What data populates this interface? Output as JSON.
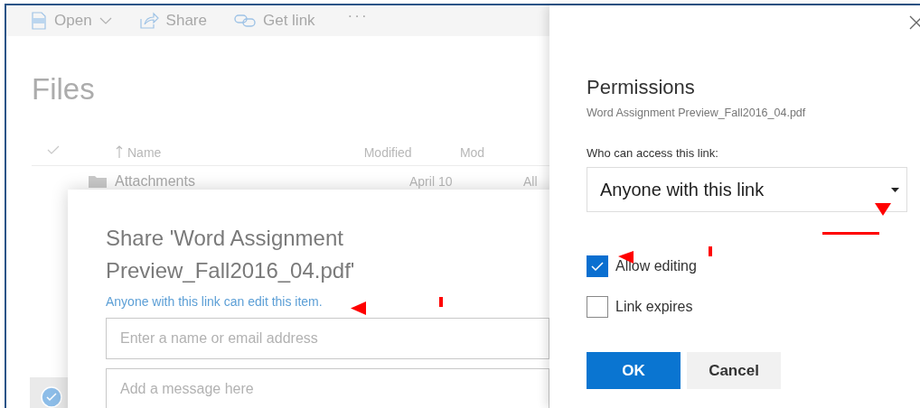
{
  "toolbar": {
    "items": [
      {
        "kind": "pdf",
        "label": "Open",
        "dropdown": true
      },
      {
        "kind": "share",
        "label": "Share",
        "dropdown": false
      },
      {
        "kind": "link",
        "label": "Get link",
        "dropdown": false
      }
    ],
    "more": "···"
  },
  "page_title": "Files",
  "table": {
    "columns": [
      {
        "label": "Name",
        "sorted": true
      },
      {
        "label": "Modified",
        "sorted": false
      },
      {
        "label": "Mod",
        "sorted": false
      }
    ],
    "rows": [
      {
        "kind": "folder",
        "cells": [
          "Attachments",
          "April 10",
          "All"
        ]
      }
    ]
  },
  "share_dialog": {
    "title": "Share 'Word Assignment Preview_Fall2016_04.pdf'",
    "link_notice": "Anyone with this link can edit this item.",
    "recipients": {
      "placeholder": "Enter a name or email address"
    },
    "message": {
      "placeholder": "Add a message here"
    }
  },
  "permissions": {
    "title": "Permissions",
    "file_name": "Word Assignment Preview_Fall2016_04.pdf",
    "access_label": "Who can access this link:",
    "access": {
      "value": "Anyone with this link"
    },
    "options": [
      {
        "label": "Allow editing",
        "checked": true
      },
      {
        "label": "Link expires",
        "checked": false
      }
    ],
    "buttons": [
      {
        "label": "OK",
        "kind": "primary"
      },
      {
        "label": "Cancel",
        "kind": "secondary"
      }
    ]
  }
}
